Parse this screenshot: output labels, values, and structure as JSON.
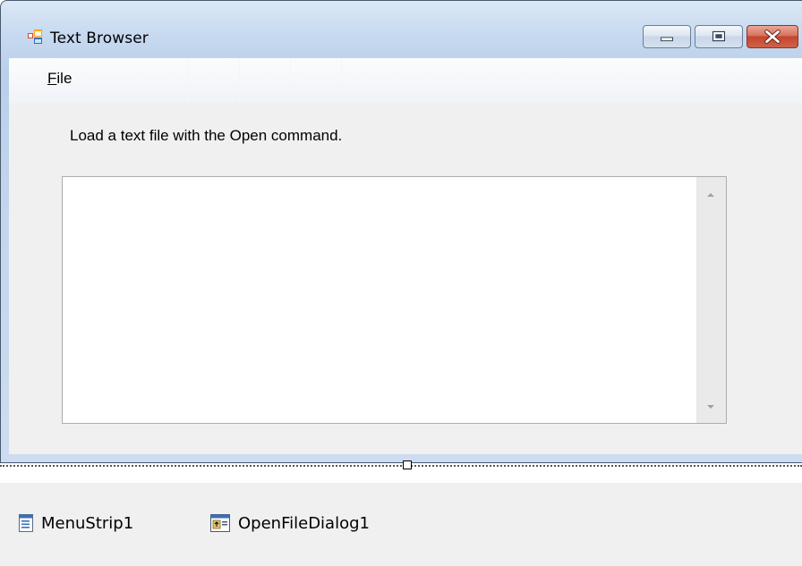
{
  "window": {
    "title": "Text Browser"
  },
  "menu": {
    "file_mnemonic": "F",
    "file_rest": "ile"
  },
  "form": {
    "instruction": "Load a text file with the Open command.",
    "textbox_value": ""
  },
  "tray": {
    "items": [
      "MenuStrip1",
      "OpenFileDialog1"
    ]
  },
  "icons": {
    "app": "form-icon",
    "minimize": "minimize-icon",
    "maximize": "maximize-icon",
    "close": "close-icon",
    "scroll_up": "scroll-up-arrow-icon",
    "scroll_down": "scroll-down-arrow-icon",
    "menustrip": "menustrip-icon",
    "openfiledialog": "openfiledialog-icon"
  },
  "colors": {
    "close_button": "#c5452c",
    "frame": "#b9cfea",
    "client": "#f0f0f0"
  }
}
